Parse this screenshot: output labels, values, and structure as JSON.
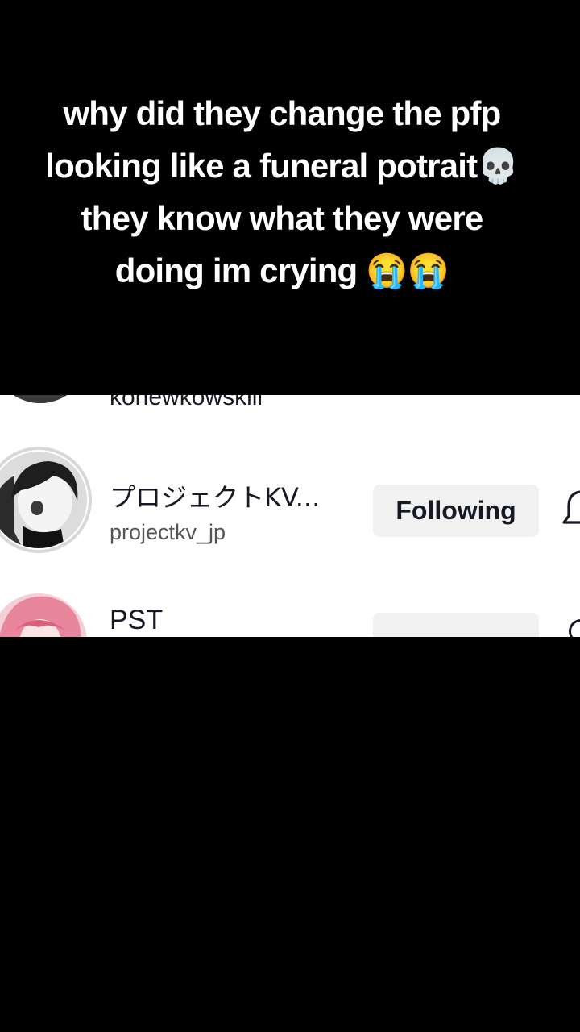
{
  "caption": {
    "text": "why did they change the pfp looking like a funeral potrait💀they know what they were doing im crying 😭😭"
  },
  "following_list": {
    "items": [
      {
        "name": "",
        "handle": "konewkowskiii",
        "button_label": "",
        "avatar": "dark-portrait-avatar"
      },
      {
        "name": "プロジェクトKV...",
        "handle": "projectkv_jp",
        "button_label": "Following",
        "avatar": "grayscale-anime-avatar",
        "icon": "bell-icon"
      },
      {
        "name": "PST",
        "handle": "",
        "button_label": "",
        "avatar": "pink-anime-avatar"
      }
    ]
  }
}
